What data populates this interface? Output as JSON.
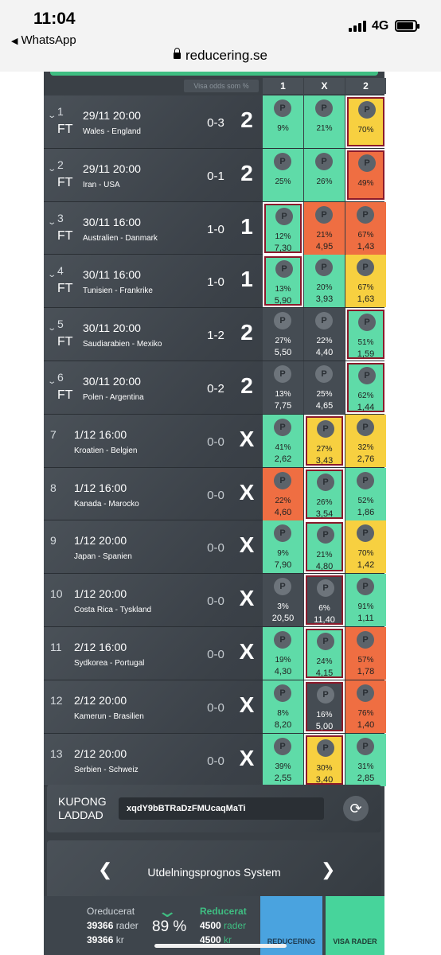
{
  "status": {
    "time": "11:04",
    "back_app": "WhatsApp",
    "network": "4G",
    "url": "reducering.se"
  },
  "colors": {
    "green": "#5fdba8",
    "yellow": "#f7d040",
    "orange": "#ef6e42",
    "grey": "#454c53"
  },
  "header": {
    "odds_toggle": "Visa odds som %",
    "cols": [
      "1",
      "X",
      "2"
    ]
  },
  "rows": [
    {
      "n": "1",
      "ft": "FT",
      "date": "29/11 20:00",
      "teams": "Wales - England",
      "score": "0-3",
      "result": "2",
      "cells": [
        {
          "c": "green",
          "pct": "9%",
          "odds": ""
        },
        {
          "c": "green",
          "pct": "21%",
          "odds": ""
        },
        {
          "c": "yellow",
          "pct": "70%",
          "odds": "",
          "win": true
        }
      ]
    },
    {
      "n": "2",
      "ft": "FT",
      "date": "29/11 20:00",
      "teams": "Iran - USA",
      "score": "0-1",
      "result": "2",
      "cells": [
        {
          "c": "green",
          "pct": "25%",
          "odds": ""
        },
        {
          "c": "green",
          "pct": "26%",
          "odds": ""
        },
        {
          "c": "orange",
          "pct": "49%",
          "odds": "",
          "win": true
        }
      ]
    },
    {
      "n": "3",
      "ft": "FT",
      "date": "30/11 16:00",
      "teams": "Australien - Danmark",
      "score": "1-0",
      "result": "1",
      "cells": [
        {
          "c": "green",
          "pct": "12%",
          "odds": "7,30",
          "win": true
        },
        {
          "c": "orange",
          "pct": "21%",
          "odds": "4,95"
        },
        {
          "c": "orange",
          "pct": "67%",
          "odds": "1,43"
        }
      ]
    },
    {
      "n": "4",
      "ft": "FT",
      "date": "30/11 16:00",
      "teams": "Tunisien - Frankrike",
      "score": "1-0",
      "result": "1",
      "cells": [
        {
          "c": "green",
          "pct": "13%",
          "odds": "5,90",
          "win": true
        },
        {
          "c": "green",
          "pct": "20%",
          "odds": "3,93"
        },
        {
          "c": "yellow",
          "pct": "67%",
          "odds": "1,63"
        }
      ]
    },
    {
      "n": "5",
      "ft": "FT",
      "date": "30/11 20:00",
      "teams": "Saudiarabien - Mexiko",
      "score": "1-2",
      "result": "2",
      "cells": [
        {
          "c": "grey",
          "pct": "27%",
          "odds": "5,50"
        },
        {
          "c": "grey",
          "pct": "22%",
          "odds": "4,40"
        },
        {
          "c": "green",
          "pct": "51%",
          "odds": "1,59",
          "win": true
        }
      ]
    },
    {
      "n": "6",
      "ft": "FT",
      "date": "30/11 20:00",
      "teams": "Polen - Argentina",
      "score": "0-2",
      "result": "2",
      "cells": [
        {
          "c": "grey",
          "pct": "13%",
          "odds": "7,75"
        },
        {
          "c": "grey",
          "pct": "25%",
          "odds": "4,65"
        },
        {
          "c": "green",
          "pct": "62%",
          "odds": "1,44",
          "win": true
        }
      ]
    },
    {
      "n": "7",
      "ft": "",
      "date": "1/12 16:00",
      "teams": "Kroatien - Belgien",
      "score": "0-0",
      "result": "X",
      "cells": [
        {
          "c": "green",
          "pct": "41%",
          "odds": "2,62"
        },
        {
          "c": "yellow",
          "pct": "27%",
          "odds": "3,43",
          "win": true
        },
        {
          "c": "yellow",
          "pct": "32%",
          "odds": "2,76"
        }
      ]
    },
    {
      "n": "8",
      "ft": "",
      "date": "1/12 16:00",
      "teams": "Kanada - Marocko",
      "score": "0-0",
      "result": "X",
      "cells": [
        {
          "c": "orange",
          "pct": "22%",
          "odds": "4,60"
        },
        {
          "c": "green",
          "pct": "26%",
          "odds": "3,54",
          "win": true
        },
        {
          "c": "green",
          "pct": "52%",
          "odds": "1,86"
        }
      ]
    },
    {
      "n": "9",
      "ft": "",
      "date": "1/12 20:00",
      "teams": "Japan - Spanien",
      "score": "0-0",
      "result": "X",
      "cells": [
        {
          "c": "green",
          "pct": "9%",
          "odds": "7,90"
        },
        {
          "c": "green",
          "pct": "21%",
          "odds": "4,80",
          "win": true
        },
        {
          "c": "yellow",
          "pct": "70%",
          "odds": "1,42"
        }
      ]
    },
    {
      "n": "10",
      "ft": "",
      "date": "1/12 20:00",
      "teams": "Costa Rica - Tyskland",
      "score": "0-0",
      "result": "X",
      "cells": [
        {
          "c": "grey",
          "pct": "3%",
          "odds": "20,50"
        },
        {
          "c": "grey",
          "pct": "6%",
          "odds": "11,40",
          "win": true
        },
        {
          "c": "green",
          "pct": "91%",
          "odds": "1,11"
        }
      ]
    },
    {
      "n": "11",
      "ft": "",
      "date": "2/12 16:00",
      "teams": "Sydkorea - Portugal",
      "score": "0-0",
      "result": "X",
      "cells": [
        {
          "c": "green",
          "pct": "19%",
          "odds": "4,30"
        },
        {
          "c": "green",
          "pct": "24%",
          "odds": "4,15",
          "win": true
        },
        {
          "c": "orange",
          "pct": "57%",
          "odds": "1,78"
        }
      ]
    },
    {
      "n": "12",
      "ft": "",
      "date": "2/12 20:00",
      "teams": "Kamerun - Brasilien",
      "score": "0-0",
      "result": "X",
      "cells": [
        {
          "c": "green",
          "pct": "8%",
          "odds": "8,20"
        },
        {
          "c": "grey",
          "pct": "16%",
          "odds": "5,00",
          "win": true
        },
        {
          "c": "orange",
          "pct": "76%",
          "odds": "1,40"
        }
      ]
    },
    {
      "n": "13",
      "ft": "",
      "date": "2/12 20:00",
      "teams": "Serbien - Schweiz",
      "score": "0-0",
      "result": "X",
      "cells": [
        {
          "c": "green",
          "pct": "39%",
          "odds": "2,55"
        },
        {
          "c": "yellow",
          "pct": "30%",
          "odds": "3,40",
          "win": true
        },
        {
          "c": "green",
          "pct": "31%",
          "odds": "2,85"
        }
      ]
    }
  ],
  "coupon": {
    "label_line1": "KUPONG",
    "label_line2": "LADDAD",
    "code": "xqdY9bBTRaDzFMUcaqMaTi"
  },
  "prognos": {
    "title": "Utdelningsprognos System",
    "left": "❮",
    "right": "❯"
  },
  "bottom": {
    "unreduced_label": "Oreducerat",
    "unreduced_rows": "39366",
    "rows_unit": "rader",
    "unreduced_kr": "39366",
    "kr_unit": "kr",
    "percent": "89 %",
    "reduced_label": "Reducerat",
    "reduced_rows": "4500",
    "reduced_kr": "4500",
    "reducering_btn": "REDUCERING",
    "visa_btn": "VISA RADER"
  }
}
